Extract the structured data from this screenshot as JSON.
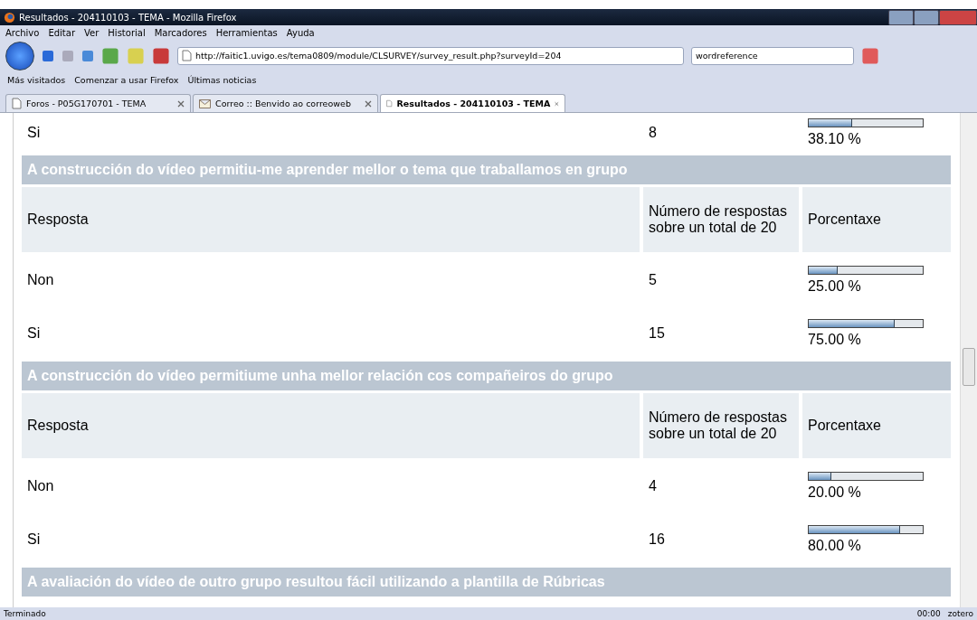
{
  "window": {
    "title": "Resultados - 204110103 - TEMA - Mozilla Firefox"
  },
  "menu": [
    "Archivo",
    "Editar",
    "Ver",
    "Historial",
    "Marcadores",
    "Herramientas",
    "Ayuda"
  ],
  "address": {
    "value": "http://faitic1.uvigo.es/tema0809/module/CLSURVEY/survey_result.php?surveyId=204"
  },
  "search": {
    "value": "wordreference"
  },
  "bookmarks": [
    "Más visitados",
    "Comenzar a usar Firefox",
    "Últimas noticias"
  ],
  "tabs": [
    {
      "label": "Foros - P05G170701 - TEMA",
      "kind": "page",
      "selected": false
    },
    {
      "label": "Correo :: Benvido ao correoweb",
      "kind": "mail",
      "selected": false
    },
    {
      "label": "Resultados - 204110103 - TEMA",
      "kind": "page",
      "selected": true
    }
  ],
  "top_rows": [
    {
      "answer": "Si",
      "count": "8",
      "level": 0.381,
      "percent": "38.10 %"
    }
  ],
  "questions": [
    {
      "title": "A construcción do vídeo permitiu-me aprender mellor o tema que traballamos en grupo",
      "columns": [
        "Resposta",
        "Número de respostas sobre un total de 20",
        "Porcentaxe"
      ],
      "rows": [
        {
          "answer": "Non",
          "count": "5",
          "level": 0.25,
          "percent": "25.00 %"
        },
        {
          "answer": "Si",
          "count": "15",
          "level": 0.75,
          "percent": "75.00 %"
        }
      ]
    },
    {
      "title": "A construcción do vídeo permitiume unha mellor relación cos compañeiros do grupo",
      "columns": [
        "Resposta",
        "Número de respostas sobre un total de 20",
        "Porcentaxe"
      ],
      "rows": [
        {
          "answer": "Non",
          "count": "4",
          "level": 0.2,
          "percent": "20.00 %"
        },
        {
          "answer": "Si",
          "count": "16",
          "level": 0.8,
          "percent": "80.00 %"
        }
      ]
    },
    {
      "title": "A avaliación do vídeo de outro grupo resultou fácil utilizando a plantilla de Rúbricas"
    }
  ],
  "status_bar": {
    "text": "Terminado",
    "time": "00:00",
    "addon": "zotero"
  }
}
